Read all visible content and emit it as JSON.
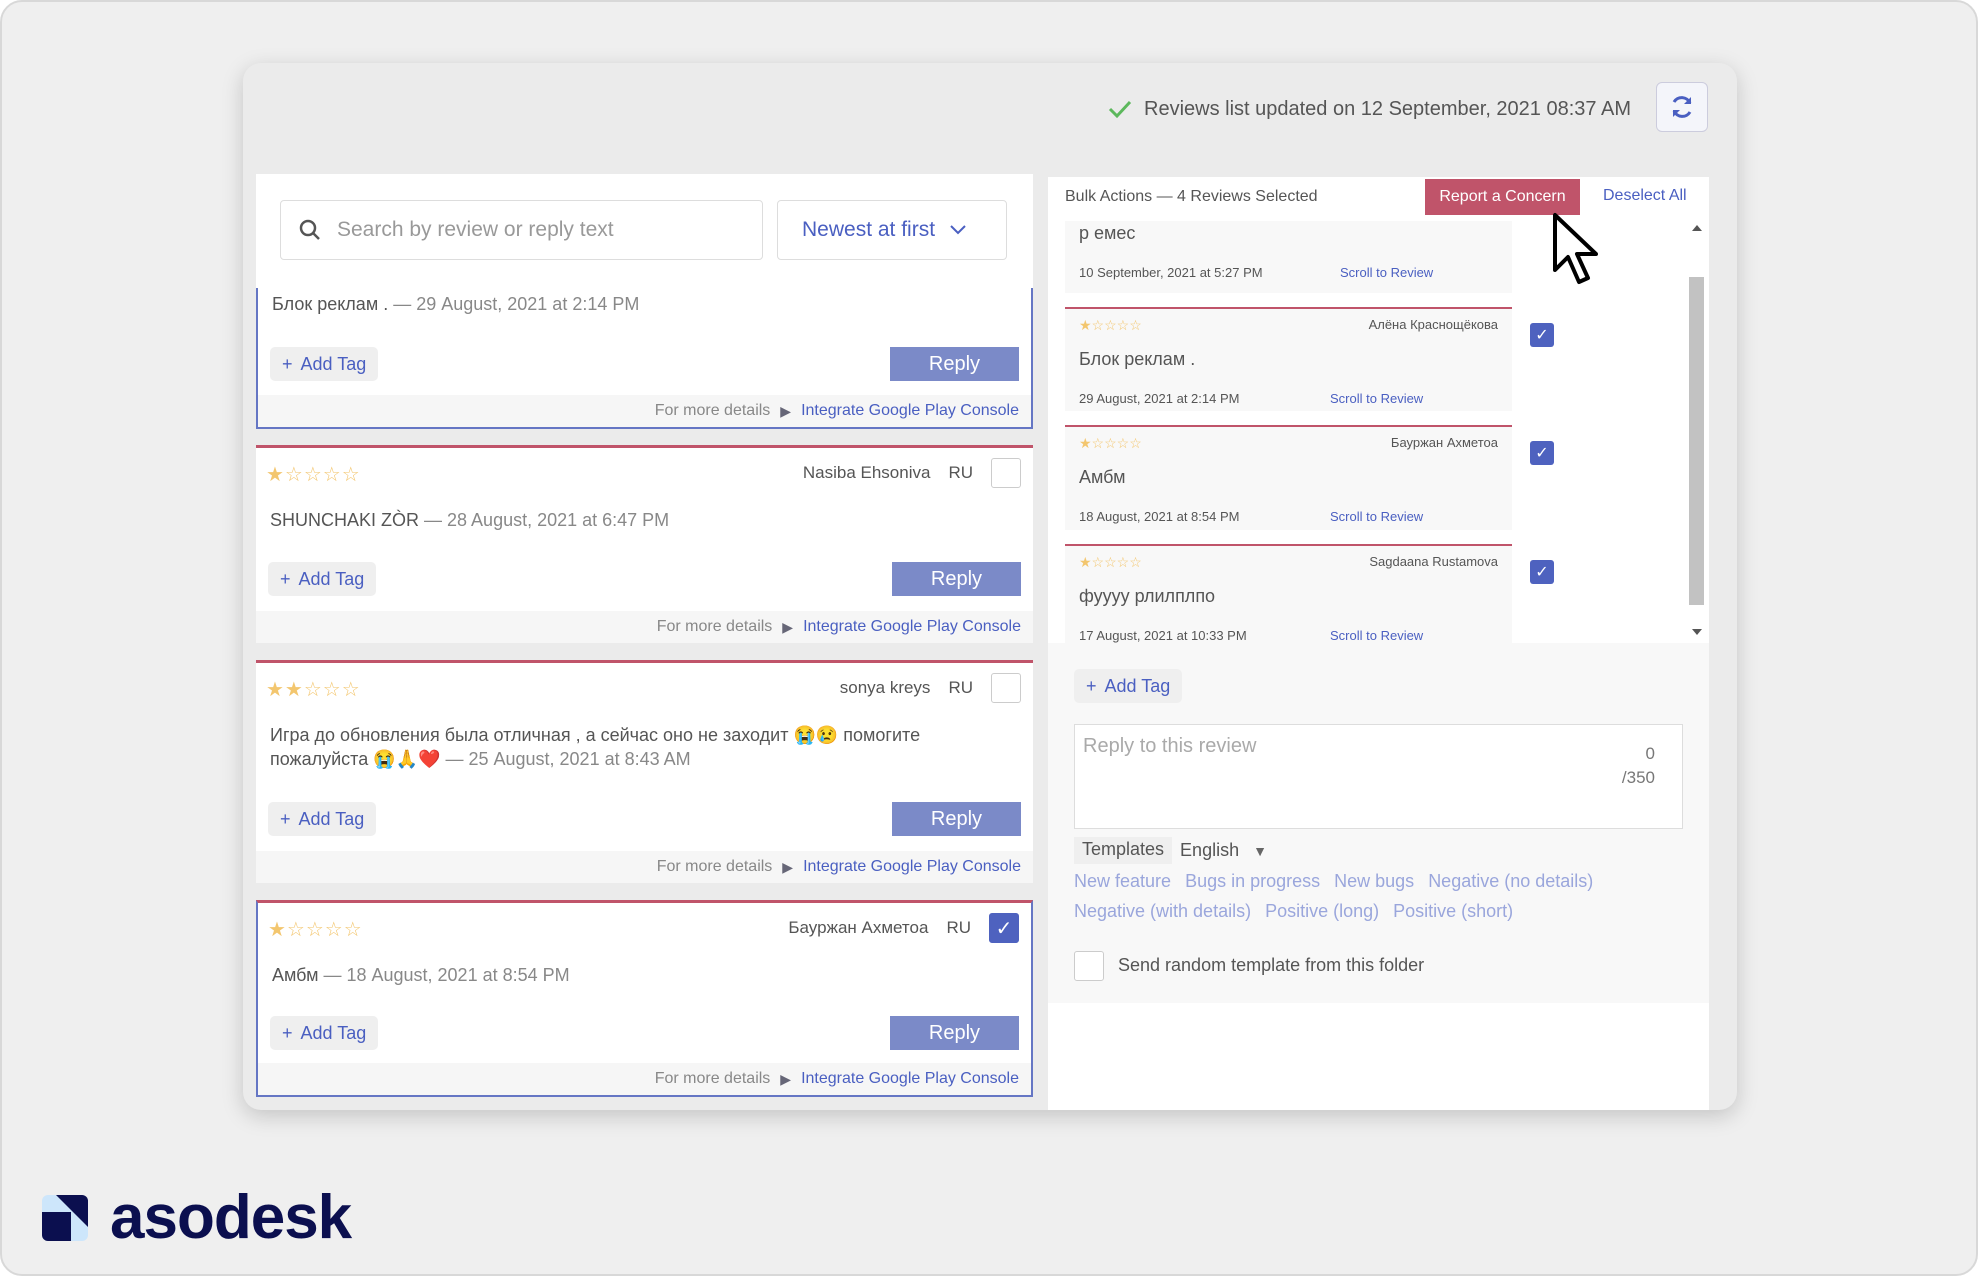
{
  "header": {
    "status_text": "Reviews list updated on 12 September, 2021 08:37 AM",
    "status_icon": "check-icon",
    "refresh_icon": "refresh-icon"
  },
  "search": {
    "placeholder": "Search by review or reply text",
    "sort_value": "Newest at first"
  },
  "colors": {
    "accent": "#4a5fc1",
    "reply": "#7b8ac8",
    "danger": "#c0546a",
    "star": "#f3c66e",
    "brand": "#0b0f4f"
  },
  "common": {
    "add_tag": "Add Tag",
    "reply": "Reply",
    "more_details": "For more details",
    "integrate": "Integrate Google Play Console"
  },
  "reviews": [
    {
      "rating": null,
      "author": null,
      "lang": null,
      "checked": true,
      "text": "Блок реклам .",
      "date": "— 29 August, 2021 at 2:14 PM"
    },
    {
      "rating": 1,
      "author": "Nasiba Ehsoniva",
      "lang": "RU",
      "checked": false,
      "text": "SHUNCHAKI ZÒR",
      "date": "— 28 August, 2021 at 6:47 PM"
    },
    {
      "rating": 2,
      "author": "sonya kreys",
      "lang": "RU",
      "checked": false,
      "text": "Игра до обновления была отличная , а сейчас оно не заходит 😭😢 помогите пожалуйста 😭🙏❤️",
      "date": "— 25 August, 2021 at 8:43 AM"
    },
    {
      "rating": 1,
      "author": "Бауржан Ахметоа",
      "lang": "RU",
      "checked": true,
      "text": "Амбм",
      "date": "— 18 August, 2021 at 8:54 PM"
    }
  ],
  "bulk": {
    "title": "Bulk Actions — 4 Reviews Selected",
    "report": "Report a Concern",
    "deselect": "Deselect All",
    "scroll_label": "Scroll to Review",
    "items": [
      {
        "rating": null,
        "author": null,
        "text": "р емес",
        "date": "10 September, 2021 at 5:27 PM",
        "checked": false
      },
      {
        "rating": 1,
        "author": "Алёна Краснощёкова",
        "text": "Блок реклам .",
        "date": "29 August, 2021 at 2:14 PM",
        "checked": true
      },
      {
        "rating": 1,
        "author": "Бауржан Ахметоа",
        "text": "Амбм",
        "date": "18 August, 2021 at 8:54 PM",
        "checked": true
      },
      {
        "rating": 1,
        "author": "Sagdaana Rustamova",
        "text": "фуууу рлилплпо",
        "date": "17 August, 2021 at 10:33 PM",
        "checked": true
      }
    ],
    "add_tag": "Add Tag",
    "reply_placeholder": "Reply to this review",
    "count": "0",
    "max": "/350",
    "templates_label": "Templates",
    "language": "English",
    "templates": [
      "New feature",
      "Bugs in progress",
      "New bugs",
      "Negative (no details)",
      "Negative (with details)",
      "Positive (long)",
      "Positive (short)"
    ],
    "random_label": "Send random template from this folder"
  },
  "brand": {
    "name": "asodesk"
  }
}
